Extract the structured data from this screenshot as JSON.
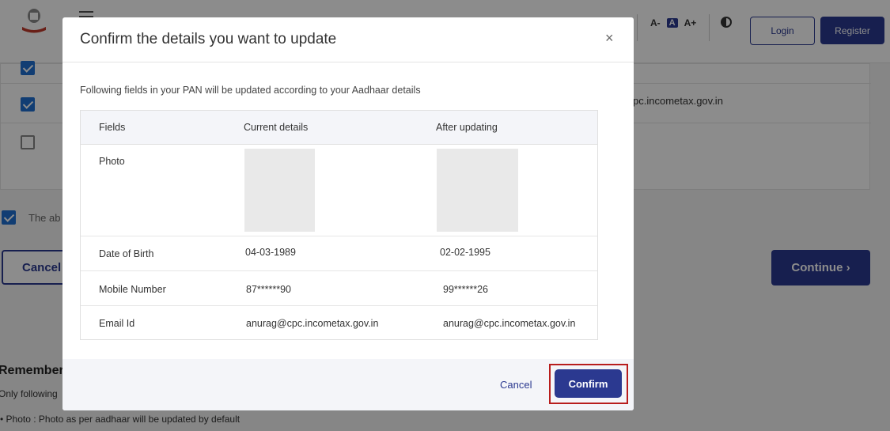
{
  "header": {
    "font_controls": [
      "A-",
      "A",
      "A+"
    ],
    "login_label": "Login",
    "register_label": "Register"
  },
  "background": {
    "email_partial": "pc.incometax.gov.in",
    "abstract_partial": "The ab",
    "cancel_label": "Cancel",
    "continue_label": "Continue ›",
    "remember_partial": "Remember",
    "only_partial": "Only following",
    "photo_note": "Photo : Photo as per aadhaar will be updated by default"
  },
  "modal": {
    "title": "Confirm the details you want to update",
    "close_glyph": "×",
    "subtitle": "Following fields in your PAN will be updated according to your Aadhaar details",
    "table": {
      "headers": [
        "Fields",
        "Current details",
        "After updating"
      ],
      "rows": [
        {
          "field": "Photo",
          "current": "",
          "after": ""
        },
        {
          "field": "Date of Birth",
          "current": "04-03-1989",
          "after": "02-02-1995"
        },
        {
          "field": "Mobile Number",
          "current": "87******90",
          "after": "99******26"
        },
        {
          "field": "Email Id",
          "current": "anurag@cpc.incometax.gov.in",
          "after": "anurag@cpc.incometax.gov.in"
        }
      ]
    },
    "cancel_label": "Cancel",
    "confirm_label": "Confirm"
  },
  "colors": {
    "primary": "#2b3990",
    "highlight": "#b81d1d",
    "checkbox": "#1f6fd1"
  }
}
